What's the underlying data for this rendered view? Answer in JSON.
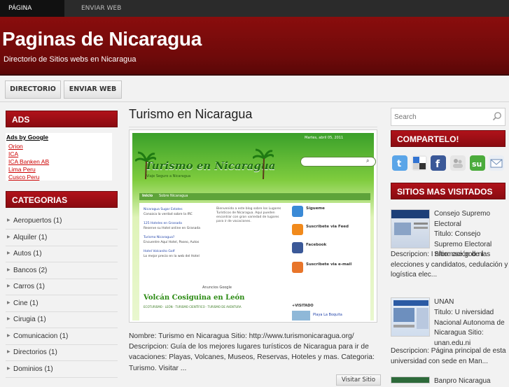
{
  "topnav": {
    "items": [
      "PÁGINA PRINCIPAL",
      "ENVIAR WEB"
    ]
  },
  "header": {
    "title": "Paginas de Nicaragua",
    "description": "Directorio de Sitios webs en Nicaragua"
  },
  "subnav": {
    "items": [
      "DIRECTORIO",
      "ENVIAR WEB"
    ]
  },
  "ads": {
    "heading": "ADS",
    "label": "Ads by Google",
    "links": [
      "Orion",
      "ICA",
      "ICA Banken AB",
      "Lima Peru",
      "Cusco Peru"
    ]
  },
  "categories": {
    "heading": "CATEGORIAS",
    "items": [
      "Aeropuertos (1)",
      "Alquiler (1)",
      "Autos (1)",
      "Bancos (2)",
      "Carros (1)",
      "Cine (1)",
      "Cirugia (1)",
      "Comunicacion (1)",
      "Directorios (1)",
      "Dominios (1)"
    ]
  },
  "post": {
    "title": "Turismo en Nicaragua",
    "body": "Nombre: Turismo en Nicaragua Sitio: http://www.turismonicaragua.org/ Descripcion: Guía de los mejores lugares turísticos de Nicaragua para ir de vacaciones: Playas, Volcanes, Museos, Reservas, Hoteles y mas. Categoria: Turismo. Visitar ...",
    "visit_label": "Visitar Sitio",
    "screenshot": {
      "date": "Martes, abril 05, 2011",
      "logo": "Turismo en Nicaragua",
      "tagline": "Viaje Seguro a Nicaragua",
      "menu": [
        "Inicio",
        "Sobre Nicaragua"
      ],
      "feature": "Volcán Cosiguina en León",
      "side_items": [
        "Sígueme",
        "Suscribete via Feed",
        "Facebook",
        "Suscribete via e-mail"
      ],
      "ads_label": "Anuncios Google",
      "visited_label": "+VISITADO",
      "visited_item": "Playa La Boquita",
      "ad_links": [
        "Nicaragua Sugar Estates",
        "125 Hoteles en Granada",
        "Turismo Nicaragua?",
        "Hotel Volcanito Golf"
      ]
    }
  },
  "search": {
    "placeholder": "Search"
  },
  "share": {
    "heading": "COMPARTELO!",
    "icons": [
      "twitter-icon",
      "delicious-icon",
      "facebook-icon",
      "myspace-icon",
      "stumbleupon-icon",
      "email-icon"
    ]
  },
  "visited": {
    "heading": "SITIOS MAS VISITADOS",
    "items": [
      {
        "title": "Consejo Supremo Electoral",
        "sub": "Titulo: Consejo Supremo Electoral Sitio: cse.gob.ni",
        "desc": "Descripcion: I nformación de las elecciones y candidatos, cedulación y logística elec..."
      },
      {
        "title": "UNAN",
        "sub": "Titulo: U niversidad Nacional Autonoma de Nicaragua Sitio: unan.edu.ni",
        "desc": "Descripcion: Página principal de esta universidad con sede en Man..."
      },
      {
        "title": "Banpro Nicaragua",
        "sub": "",
        "desc": ""
      }
    ]
  },
  "colors": {
    "accent": "#8a0b11",
    "header": "#6e0a0a",
    "link": "#cc0000"
  }
}
